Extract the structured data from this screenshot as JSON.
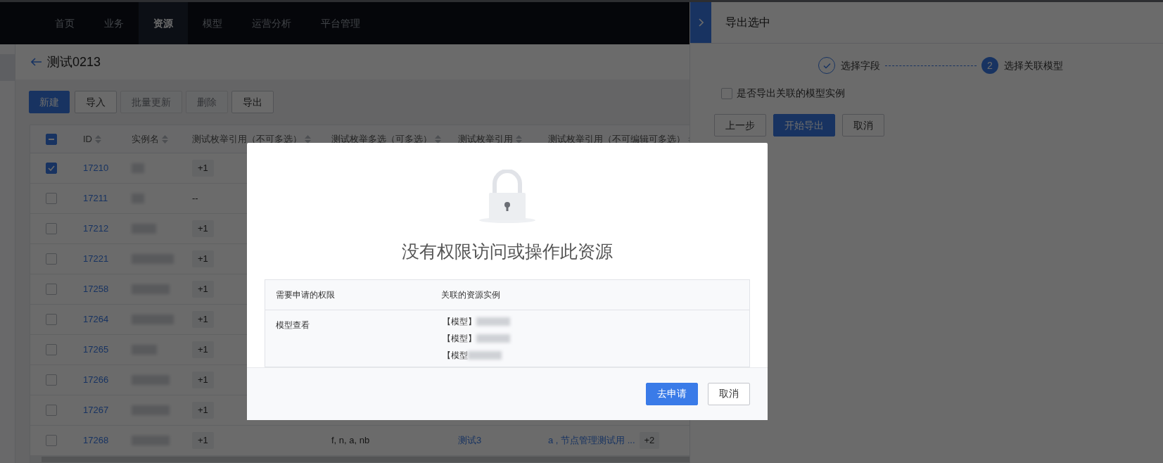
{
  "nav": {
    "items": [
      {
        "label": "首页",
        "selected": false
      },
      {
        "label": "业务",
        "selected": false
      },
      {
        "label": "资源",
        "selected": true
      },
      {
        "label": "模型",
        "selected": false
      },
      {
        "label": "运营分析",
        "selected": false
      },
      {
        "label": "平台管理",
        "selected": false
      }
    ]
  },
  "page": {
    "title": "测试0213",
    "toolbar": [
      {
        "label": "新建",
        "kind": "primary",
        "disabled": false
      },
      {
        "label": "导入",
        "kind": "default",
        "disabled": false
      },
      {
        "label": "批量更新",
        "kind": "default",
        "disabled": true
      },
      {
        "label": "删除",
        "kind": "default",
        "disabled": true
      },
      {
        "label": "导出",
        "kind": "default",
        "disabled": false
      }
    ]
  },
  "table": {
    "select_all": {
      "indeterminate": true
    },
    "columns": [
      "ID",
      "实例名",
      "测试枚举引用（不可多选）",
      "测试枚举多选（可多选）",
      "测试枚举引用",
      "测试枚举引用（不可编辑可多选）"
    ],
    "rows": [
      {
        "checked": true,
        "id": "17210",
        "column_3": {
          "kind": "tag",
          "text": "+1"
        }
      },
      {
        "checked": false,
        "id": "17211",
        "column_3": {
          "kind": "text",
          "text": "--"
        }
      },
      {
        "checked": false,
        "id": "17212",
        "column_3": {
          "kind": "tag",
          "text": "+1"
        }
      },
      {
        "checked": false,
        "id": "17221",
        "column_3": {
          "kind": "tag",
          "text": "+1"
        }
      },
      {
        "checked": false,
        "id": "17258",
        "column_3": {
          "kind": "tag",
          "text": "+1"
        }
      },
      {
        "checked": false,
        "id": "17264",
        "column_3": {
          "kind": "tag",
          "text": "+1"
        }
      },
      {
        "checked": false,
        "id": "17265",
        "column_3": {
          "kind": "tag",
          "text": "+1"
        }
      },
      {
        "checked": false,
        "id": "17266",
        "column_3": {
          "kind": "tag",
          "text": "+1"
        }
      },
      {
        "checked": false,
        "id": "17267",
        "column_3": {
          "kind": "tag",
          "text": "+1"
        }
      },
      {
        "checked": false,
        "id": "17268",
        "column_3": {
          "kind": "tag",
          "text": "+1"
        },
        "column_4": "f, n, a, nb",
        "column_5": "测试3",
        "column_6": {
          "text": "a , 节点管理测试用 ...",
          "extra": "+2"
        }
      }
    ]
  },
  "drawer": {
    "title": "导出选中",
    "steps": [
      {
        "label": "选择字段",
        "done": true
      },
      {
        "label": "选择关联模型",
        "done": false,
        "number": "2"
      }
    ],
    "option": {
      "label": "是否导出关联的模型实例",
      "checked": false
    },
    "buttons": [
      {
        "label": "上一步",
        "kind": "default"
      },
      {
        "label": "开始导出",
        "kind": "primary"
      },
      {
        "label": "取消",
        "kind": "default"
      }
    ]
  },
  "dialog": {
    "title": "没有权限访问或操作此资源",
    "headers": [
      "需要申请的权限",
      "关联的资源实例"
    ],
    "rows": [
      {
        "permission": "模型查看",
        "instances": [
          "【模型】",
          "【模型】",
          "【模型"
        ]
      }
    ],
    "buttons": [
      {
        "label": "去申请",
        "kind": "primary"
      },
      {
        "label": "取消",
        "kind": "default"
      }
    ]
  }
}
